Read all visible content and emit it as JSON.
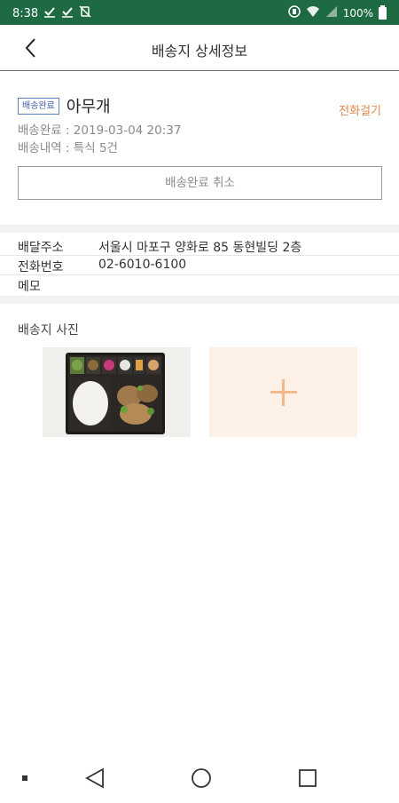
{
  "status_bar": {
    "time": "8:38",
    "battery": "100%",
    "left_icons": [
      "check-icon",
      "check-icon",
      "sync-off-icon"
    ],
    "right_icons": [
      "vibrate-icon",
      "wifi-icon",
      "signal-icon",
      "battery-icon"
    ]
  },
  "header": {
    "title": "배송지 상세정보",
    "back_icon": "back-arrow-icon"
  },
  "summary": {
    "badge": "배송완료",
    "name": "아무개",
    "call_label": "전화걸기",
    "completed_line": "배송완료 : 2019-03-04 20:37",
    "history_line": "배송내역 : 특식 5건",
    "cancel_button": "배송완료 취소"
  },
  "info": {
    "rows": [
      {
        "label": "배달주소",
        "value": "서울시 마포구 양화로 85 동현빌딩 2층"
      },
      {
        "label": "전화번호",
        "value": "02-6010-6100"
      },
      {
        "label": "메모",
        "value": ""
      }
    ]
  },
  "photos": {
    "title": "배송지 사진",
    "add_icon": "plus-icon",
    "count": 1
  },
  "colors": {
    "status_bar": "#1e6b43",
    "accent_orange": "#e08a4b",
    "badge_blue": "#3e5fa6",
    "add_tile_bg": "#fdf1e7"
  },
  "nav": {
    "icons": [
      "overview-dot-icon",
      "back-triangle-icon",
      "home-circle-icon",
      "recents-square-icon"
    ]
  }
}
